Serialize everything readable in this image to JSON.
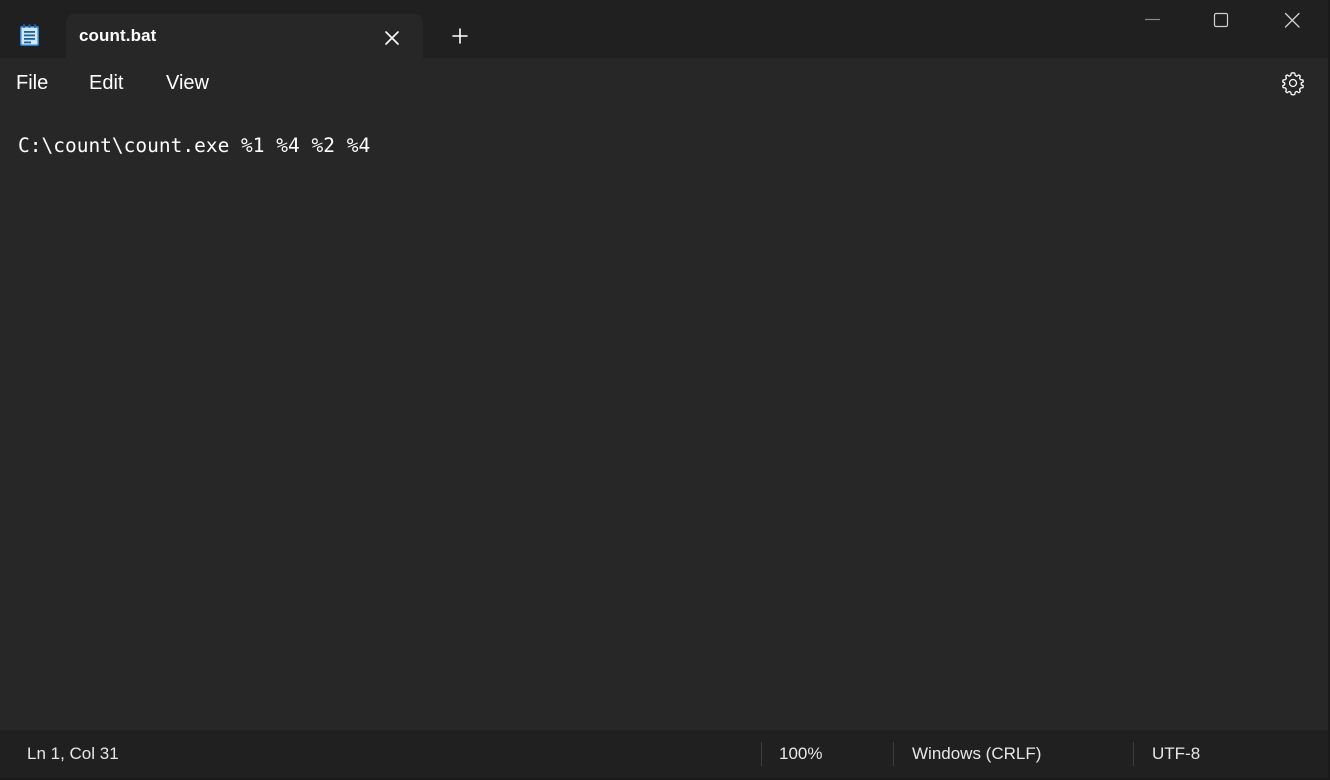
{
  "tab": {
    "title": "count.bat"
  },
  "menu": {
    "items": [
      "File",
      "Edit",
      "View"
    ]
  },
  "editor": {
    "content": "C:\\count\\count.exe %1 %4 %2 %4"
  },
  "status": {
    "position": "Ln 1, Col 31",
    "zoom": "100%",
    "line_ending": "Windows (CRLF)",
    "encoding": "UTF-8"
  },
  "icons": {
    "app": "notepad-icon",
    "tab_close": "close-icon",
    "new_tab": "plus-icon",
    "minimize": "minimize-icon",
    "maximize": "maximize-icon",
    "close": "close-icon",
    "settings": "gear-icon"
  },
  "colors": {
    "background": "#272727",
    "titlebar": "#202020",
    "text": "#ffffff",
    "icon_accent": "#4fc3f7"
  }
}
